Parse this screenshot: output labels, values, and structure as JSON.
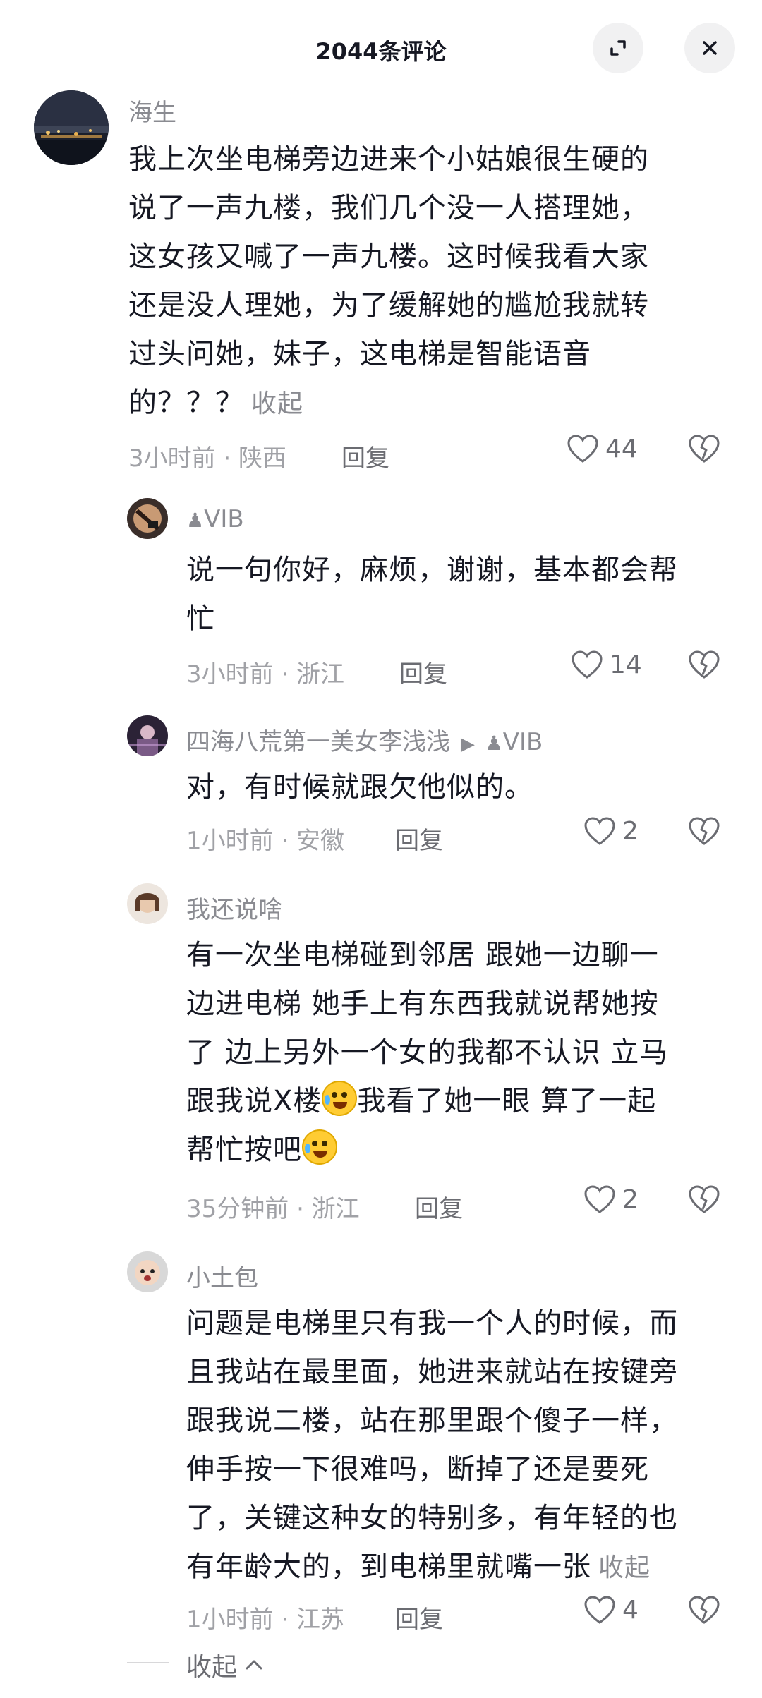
{
  "header": {
    "title": "2044条评论",
    "expand_icon": "expand-icon",
    "close_icon": "close-icon"
  },
  "comments": [
    {
      "user": "海生",
      "text": "我上次坐电梯旁边进来个小姑娘很生硬的\n说了一声九楼，我们几个没一人搭理她，\n这女孩又喊了一声九楼。这时候我看大家\n还是没人理她，为了缓解她的尴尬我就转\n过头问她，妹子，这电梯是智能语音\n的？？？",
      "collapse": "收起",
      "meta": "3小时前 · 陕西",
      "reply": "回复",
      "likes": "44"
    },
    {
      "user": "VIB",
      "text": "说一句你好，麻烦，谢谢，基本都会帮\n忙",
      "meta": "3小时前 · 浙江",
      "reply": "回复",
      "likes": "14"
    },
    {
      "user": "四海八荒第一美女李浅浅",
      "reply_to": "VIB",
      "text": "对，有时候就跟欠他似的。",
      "meta": "1小时前 · 安徽",
      "reply": "回复",
      "likes": "2"
    },
    {
      "user": "我还说啥",
      "text_l1": "有一次坐电梯碰到邻居 跟她一边聊一",
      "text_l2": "边进电梯 她手上有东西我就说帮她按",
      "text_l3": "了 边上另外一个女的我都不认识 立马",
      "text_l4a": "跟我说X楼",
      "text_l4b": "我看了她一眼 算了一起",
      "text_l5": "帮忙按吧",
      "meta": "35分钟前 · 浙江",
      "reply": "回复",
      "likes": "2"
    },
    {
      "user": "小土包",
      "text": "问题是电梯里只有我一个人的时候，而\n且我站在最里面，她进来就站在按键旁\n跟我说二楼，站在那里跟个傻子一样，\n伸手按一下很难吗，断掉了还是要死\n了，关键这种女的特别多，有年轻的也\n有年龄大的，到电梯里就嘴一张",
      "collapse": "收起",
      "meta": "1小时前 · 江苏",
      "reply": "回复",
      "likes": "4"
    }
  ],
  "footer": {
    "collapse": "收起"
  }
}
